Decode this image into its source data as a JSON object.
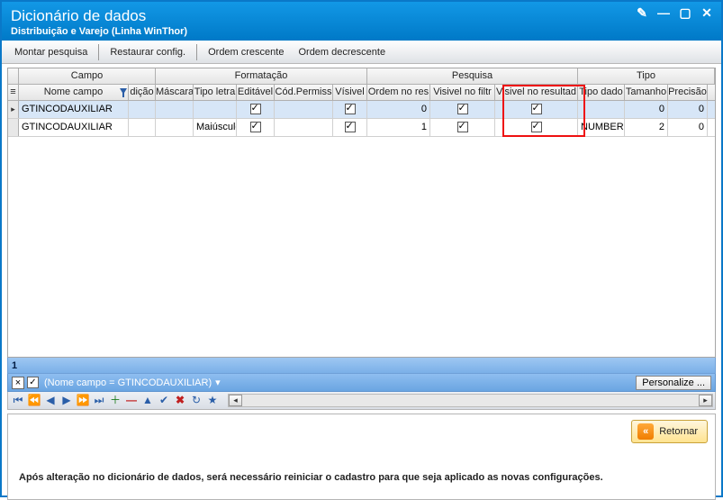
{
  "window": {
    "title": "Dicionário de dados",
    "subtitle": "Distribuição e Varejo (Linha WinThor)"
  },
  "toolbar": {
    "montar": "Montar pesquisa",
    "restaurar": "Restaurar config.",
    "ordem_cresc": "Ordem crescente",
    "ordem_decresc": "Ordem decrescente"
  },
  "grid": {
    "groups": {
      "campo": "Campo",
      "formatacao": "Formatação",
      "pesquisa": "Pesquisa",
      "tipo": "Tipo"
    },
    "columns": {
      "nome": "Nome campo",
      "edicao": "dição",
      "mascara": "Máscara",
      "tipoletra": "Tipo letra",
      "editavel": "Editável",
      "codpermiss": "Cód.Permiss",
      "visivel": "Vísivel",
      "ordem": "Ordem no res",
      "vfiltro": "Visivel no filtr",
      "vresult": "Visivel no resultad",
      "tipodado": "Tipo dado",
      "tamanho": "Tamanho",
      "precisao": "Precisão"
    },
    "rows": [
      {
        "nome": "GTINCODAUXILIAR",
        "edicao": "",
        "mascara": "",
        "tipoletra": "",
        "editavel": true,
        "codpermiss": "",
        "visivel": true,
        "ordem": "0",
        "vfiltro": true,
        "vresult": true,
        "tipodado": "",
        "tamanho": "0",
        "precisao": "0",
        "selected": true
      },
      {
        "nome": "GTINCODAUXILIAR",
        "edicao": "",
        "mascara": "",
        "tipoletra": "Maiúsculo",
        "editavel": true,
        "codpermiss": "",
        "visivel": true,
        "ordem": "1",
        "vfiltro": true,
        "vresult": true,
        "tipodado": "NUMBER",
        "tamanho": "2",
        "precisao": "0",
        "selected": false
      }
    ]
  },
  "pager": {
    "value": "1"
  },
  "filter_bar": {
    "text": "(Nome campo = GTINCODAUXILIAR)",
    "personalize": "Personalize ..."
  },
  "bottom": {
    "return": "Retornar",
    "note": "Após alteração no dicionário de dados, será necessário reiniciar o cadastro para que seja aplicado as novas configurações."
  }
}
